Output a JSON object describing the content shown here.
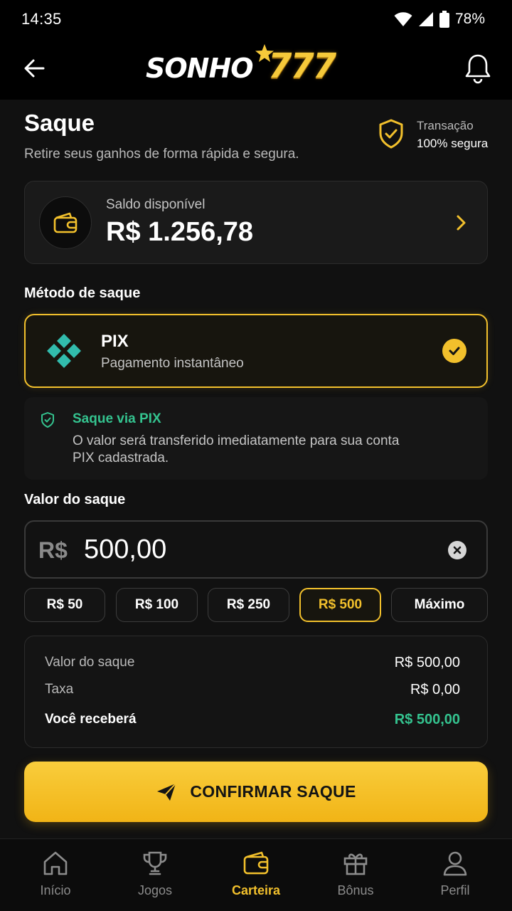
{
  "status_bar": {
    "time": "14:35",
    "battery": "78%"
  },
  "header": {
    "logo_text": "SONHO",
    "logo_number": "777"
  },
  "page": {
    "title": "Saque",
    "subtitle": "Retire seus ganhos de forma rápida e segura.",
    "secure_line1": "Transação",
    "secure_line2": "100% segura"
  },
  "balance": {
    "label": "Saldo disponível",
    "value": "R$ 1.256,78"
  },
  "method": {
    "section_label": "Método de saque",
    "name": "PIX",
    "description": "Pagamento instantâneo",
    "selected": true
  },
  "info": {
    "title": "Saque via PIX",
    "text": "O valor será transferido imediatamente para sua conta PIX cadastrada."
  },
  "amount": {
    "section_label": "Valor do saque",
    "prefix": "R$",
    "value": "500,00"
  },
  "chips": {
    "c50": "R$ 50",
    "c100": "R$ 100",
    "c250": "R$ 250",
    "c500": "R$ 500",
    "max": "Máximo",
    "selected": "R$ 500"
  },
  "summary": {
    "withdraw_label": "Valor do saque",
    "withdraw_value": "R$ 500,00",
    "fee_label": "Taxa",
    "fee_value": "R$ 0,00",
    "receive_label": "Você receberá",
    "receive_value": "R$ 500,00"
  },
  "confirm_label": "CONFIRMAR SAQUE",
  "nav": {
    "home": "Início",
    "games": "Jogos",
    "wallet": "Carteira",
    "bonus": "Bônus",
    "profile": "Perfil",
    "active": "Carteira"
  },
  "colors": {
    "accent": "#f2c02c",
    "success": "#34c38f",
    "pix": "#32bcad",
    "background": "#111111"
  }
}
